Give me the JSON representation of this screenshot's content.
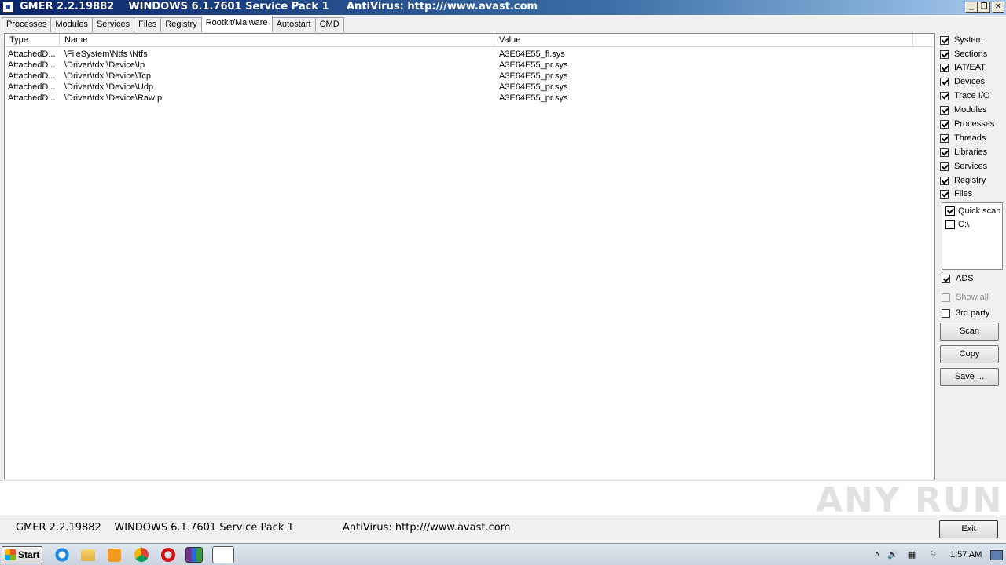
{
  "window": {
    "title": "GMER 2.2.19882    WINDOWS 6.1.7601 Service Pack 1",
    "antivirus": "AntiVirus: http:///www.avast.com"
  },
  "tabs": [
    "Processes",
    "Modules",
    "Services",
    "Files",
    "Registry",
    "Rootkit/Malware",
    "Autostart",
    "CMD"
  ],
  "active_tab": "Rootkit/Malware",
  "list": {
    "columns": [
      "Type",
      "Name",
      "Value"
    ],
    "rows": [
      [
        "AttachedD...",
        "\\FileSystem\\Ntfs \\Ntfs",
        "A3E64E55_fl.sys"
      ],
      [
        "AttachedD...",
        "\\Driver\\tdx \\Device\\Ip",
        "A3E64E55_pr.sys"
      ],
      [
        "AttachedD...",
        "\\Driver\\tdx \\Device\\Tcp",
        "A3E64E55_pr.sys"
      ],
      [
        "AttachedD...",
        "\\Driver\\tdx \\Device\\Udp",
        "A3E64E55_pr.sys"
      ],
      [
        "AttachedD...",
        "\\Driver\\tdx \\Device\\RawIp",
        "A3E64E55_pr.sys"
      ]
    ]
  },
  "options": [
    {
      "label": "System",
      "checked": true
    },
    {
      "label": "Sections",
      "checked": true
    },
    {
      "label": "IAT/EAT",
      "checked": true
    },
    {
      "label": "Devices",
      "checked": true
    },
    {
      "label": "Trace I/O",
      "checked": true
    },
    {
      "label": "Modules",
      "checked": true
    },
    {
      "label": "Processes",
      "checked": true
    },
    {
      "label": "Threads",
      "checked": true
    },
    {
      "label": "Libraries",
      "checked": true
    },
    {
      "label": "Services",
      "checked": true
    },
    {
      "label": "Registry",
      "checked": true
    },
    {
      "label": "Files",
      "checked": true
    }
  ],
  "file_targets": [
    {
      "label": "Quick scan",
      "checked": true
    },
    {
      "label": "C:\\",
      "checked": false
    }
  ],
  "extra_options": [
    {
      "label": "ADS",
      "checked": true,
      "disabled": false
    },
    {
      "label": "Show all",
      "checked": false,
      "disabled": true
    },
    {
      "label": "3rd party",
      "checked": false,
      "disabled": false
    }
  ],
  "buttons": {
    "scan": "Scan",
    "copy": "Copy",
    "save": "Save ...",
    "exit": "Exit"
  },
  "status": {
    "left": "GMER 2.2.19882    WINDOWS 6.1.7601 Service Pack 1",
    "right": "AntiVirus: http:///www.avast.com"
  },
  "watermark": "ANY RUN",
  "taskbar": {
    "start_label": "Start",
    "clock": "1:57 AM",
    "icons": [
      "ie-icon",
      "folder-icon",
      "media-player-icon",
      "chrome-icon",
      "opera-icon",
      "winrar-icon",
      "gmer-icon"
    ]
  },
  "colors": {
    "title_start": "#0a246a",
    "title_end": "#a6caf0"
  }
}
